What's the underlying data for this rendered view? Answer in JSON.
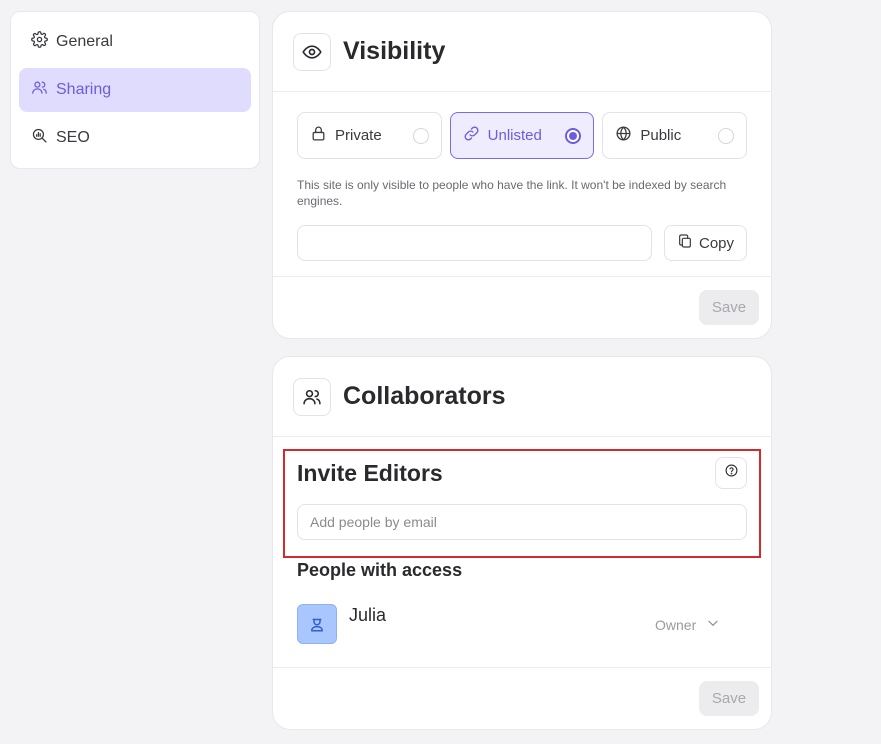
{
  "sidebar": {
    "items": [
      {
        "label": "General",
        "icon": "gear-icon",
        "active": false
      },
      {
        "label": "Sharing",
        "icon": "users-icon",
        "active": true
      },
      {
        "label": "SEO",
        "icon": "seo-search-icon",
        "active": false
      }
    ]
  },
  "visibility": {
    "title": "Visibility",
    "options": [
      {
        "label": "Private",
        "icon": "lock-icon",
        "selected": false
      },
      {
        "label": "Unlisted",
        "icon": "link-icon",
        "selected": true
      },
      {
        "label": "Public",
        "icon": "globe-icon",
        "selected": false
      }
    ],
    "description": "This site is only visible to people who have the link. It won't be indexed by search engines.",
    "link_value": "",
    "copy_label": "Copy",
    "save_label": "Save"
  },
  "collaborators": {
    "title": "Collaborators",
    "invite_title": "Invite Editors",
    "email_placeholder": "Add people by email",
    "access_title": "People with access",
    "people": [
      {
        "name": "Julia",
        "role": "Owner"
      }
    ],
    "save_label": "Save"
  },
  "colors": {
    "accent": "#6b5ce0",
    "accent_bg": "#e0dcfd",
    "highlight_border": "#d6292c"
  }
}
